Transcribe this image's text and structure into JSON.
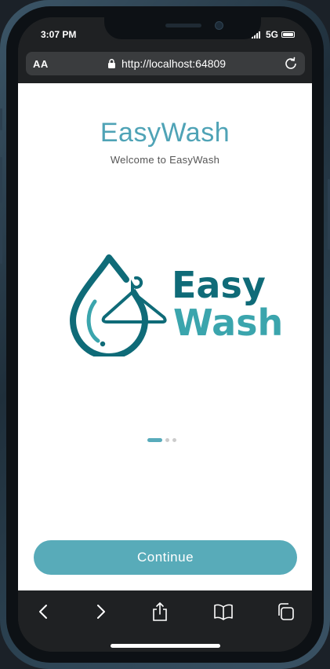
{
  "status": {
    "time": "3:07 PM",
    "network": "5G"
  },
  "browser": {
    "text_size_label": "AA",
    "url": "http://localhost:64809"
  },
  "app": {
    "title": "EasyWash",
    "subtitle": "Welcome to EasyWash",
    "logo": {
      "line1": "Easy",
      "line2": "Wash"
    },
    "pager": {
      "total": 3,
      "current": 1
    },
    "continue_label": "Continue"
  },
  "colors": {
    "accent": "#58abb9",
    "title": "#4fa3b6",
    "logo_dark": "#0f6b78",
    "logo_light": "#3ba5ad"
  },
  "toolbar_icons": [
    "back-icon",
    "forward-icon",
    "share-icon",
    "bookmarks-icon",
    "tabs-icon"
  ]
}
